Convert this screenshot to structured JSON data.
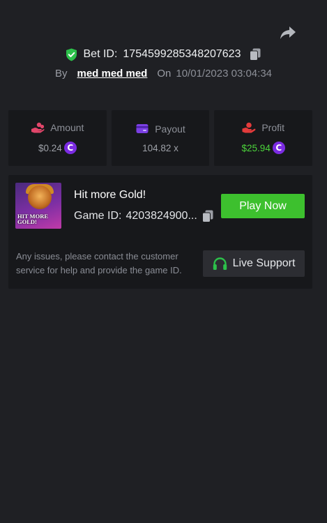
{
  "header": {
    "share_icon": "share-arrow-icon",
    "bet_label": "Bet ID:",
    "bet_id": "1754599285348207623",
    "by_label": "By",
    "username": "med med med",
    "on_label": "On",
    "datetime": "10/01/2023 03:04:34"
  },
  "stats": [
    {
      "icon": "hand-coins-icon",
      "label": "Amount",
      "value": "$0.24",
      "coin": "C"
    },
    {
      "icon": "wallet-icon",
      "label": "Payout",
      "value": "104.82 x"
    },
    {
      "icon": "profit-hand-icon",
      "label": "Profit",
      "value": "$25.94",
      "coin": "C"
    }
  ],
  "game": {
    "title": "Hit more Gold!",
    "thumbnail_text": "HIT MORE GOLD!",
    "game_id_label": "Game ID:",
    "game_id": "4203824900...",
    "play_label": "Play Now",
    "issues_text": "Any issues, please contact the customer service for help and provide the game ID.",
    "support_label": "Live Support"
  },
  "colors": {
    "background": "#1f2024",
    "card": "#17181b",
    "accent_green": "#3dc02e",
    "profit_green": "#4cd43b",
    "coin_purple": "#7b2be2",
    "amount_icon": "#e2466a",
    "payout_icon": "#7b3fe4",
    "profit_icon": "#e43b3b",
    "verified_green": "#2cc04a"
  }
}
